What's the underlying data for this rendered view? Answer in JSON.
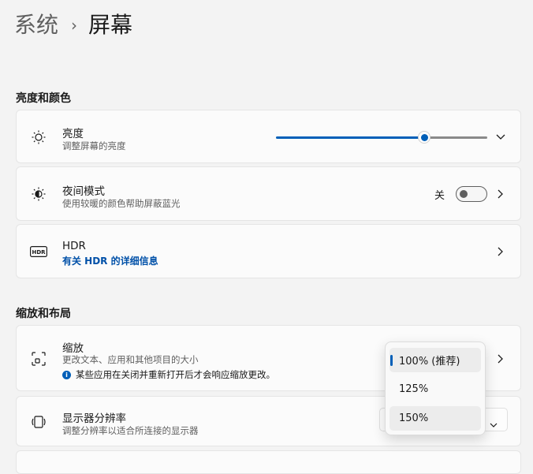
{
  "breadcrumb": {
    "parent": "系统",
    "separator": "›",
    "current": "屏幕"
  },
  "sections": {
    "brightness_color": "亮度和颜色",
    "scale_layout": "缩放和布局"
  },
  "brightness": {
    "title": "亮度",
    "subtitle": "调整屏幕的亮度",
    "level_percent": 70
  },
  "night_light": {
    "title": "夜间模式",
    "subtitle": "使用较暖的颜色帮助屏蔽蓝光",
    "state_label": "关"
  },
  "hdr": {
    "title": "HDR",
    "link": "有关 HDR 的详细信息"
  },
  "scale": {
    "title": "缩放",
    "subtitle": "更改文本、应用和其他项目的大小",
    "info": "某些应用在关闭并重新打开后才会响应缩放更改。",
    "options": [
      "100% (推荐)",
      "125%",
      "150%"
    ],
    "selected": "100% (推荐)"
  },
  "resolution": {
    "title": "显示器分辨率",
    "subtitle": "调整分辨率以适合所连接的显示器"
  },
  "colors": {
    "accent": "#005fb8",
    "link": "#0050a8"
  }
}
